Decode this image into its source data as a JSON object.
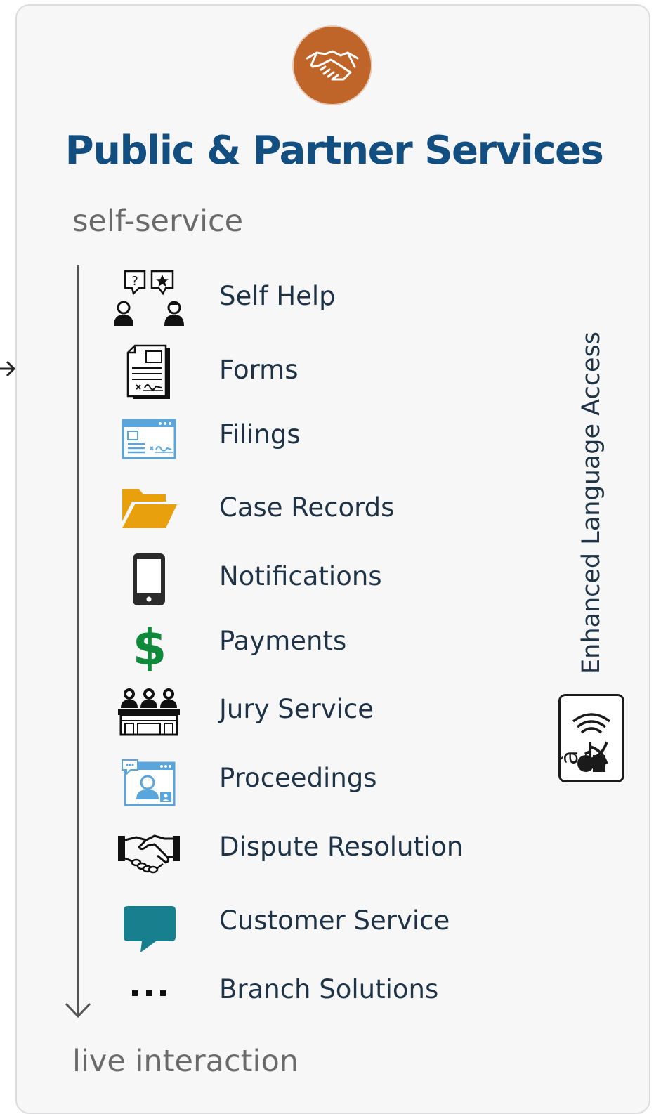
{
  "title": "Public & Partner Services",
  "scale": {
    "top_label": "self-service",
    "bottom_label": "live  interaction"
  },
  "header_icon": "handshake-icon",
  "items": [
    {
      "label": "Self Help",
      "icon": "self-help-icon"
    },
    {
      "label": "Forms",
      "icon": "forms-icon"
    },
    {
      "label": "Filings",
      "icon": "filings-icon"
    },
    {
      "label": "Case Records",
      "icon": "folder-icon"
    },
    {
      "label": "Notifications",
      "icon": "mobile-phone-icon"
    },
    {
      "label": "Payments",
      "icon": "dollar-icon"
    },
    {
      "label": "Jury Service",
      "icon": "jury-box-icon"
    },
    {
      "label": "Proceedings",
      "icon": "video-proceeding-icon"
    },
    {
      "label": "Dispute Resolution",
      "icon": "handshake-icon"
    },
    {
      "label": "Customer Service",
      "icon": "chat-bubble-icon"
    },
    {
      "label": "Branch Solutions",
      "icon": "ellipsis-icon"
    }
  ],
  "language_access": {
    "label": "Enhanced Language Access",
    "icon": "translation-icon"
  },
  "colors": {
    "title": "#124f80",
    "header_icon_bg": "#c0652a",
    "folder": "#e8a10c",
    "dollar": "#0f8a3a",
    "chat": "#177f8e",
    "window_blue": "#5aa6dc"
  }
}
